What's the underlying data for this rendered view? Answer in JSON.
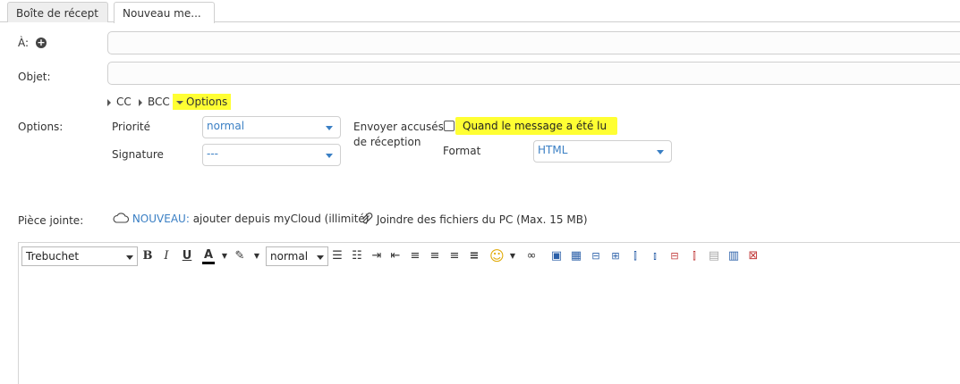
{
  "tabs": {
    "inbox": "Boîte de récept",
    "new_message": "Nouveau me..."
  },
  "compose": {
    "to_label": "À:",
    "subject_label": "Objet:",
    "cc_label": "CC",
    "bcc_label": "BCC",
    "options_toggle": "Options"
  },
  "options": {
    "label": "Options:",
    "priority_label": "Priorité",
    "priority_value": "normal",
    "signature_label": "Signature",
    "signature_value": "---",
    "receipt_label_line1": "Envoyer accusés",
    "receipt_label_line2": "de réception",
    "receipt_option": "Quand le message a été lu",
    "format_label": "Format",
    "format_value": "HTML"
  },
  "attachment": {
    "label": "Pièce jointe:",
    "nouveau": "NOUVEAU:",
    "mycloud": "ajouter depuis myCloud (illimité)",
    "pc": "Joindre des fichiers du PC (Max. 15 MB)"
  },
  "toolbar": {
    "font": "Trebuchet",
    "size": "normal",
    "bold": "B",
    "italic": "I",
    "underline": "U",
    "font_color": "A"
  },
  "colors": {
    "highlight": "#ffff33",
    "link": "#3a7fc4"
  }
}
